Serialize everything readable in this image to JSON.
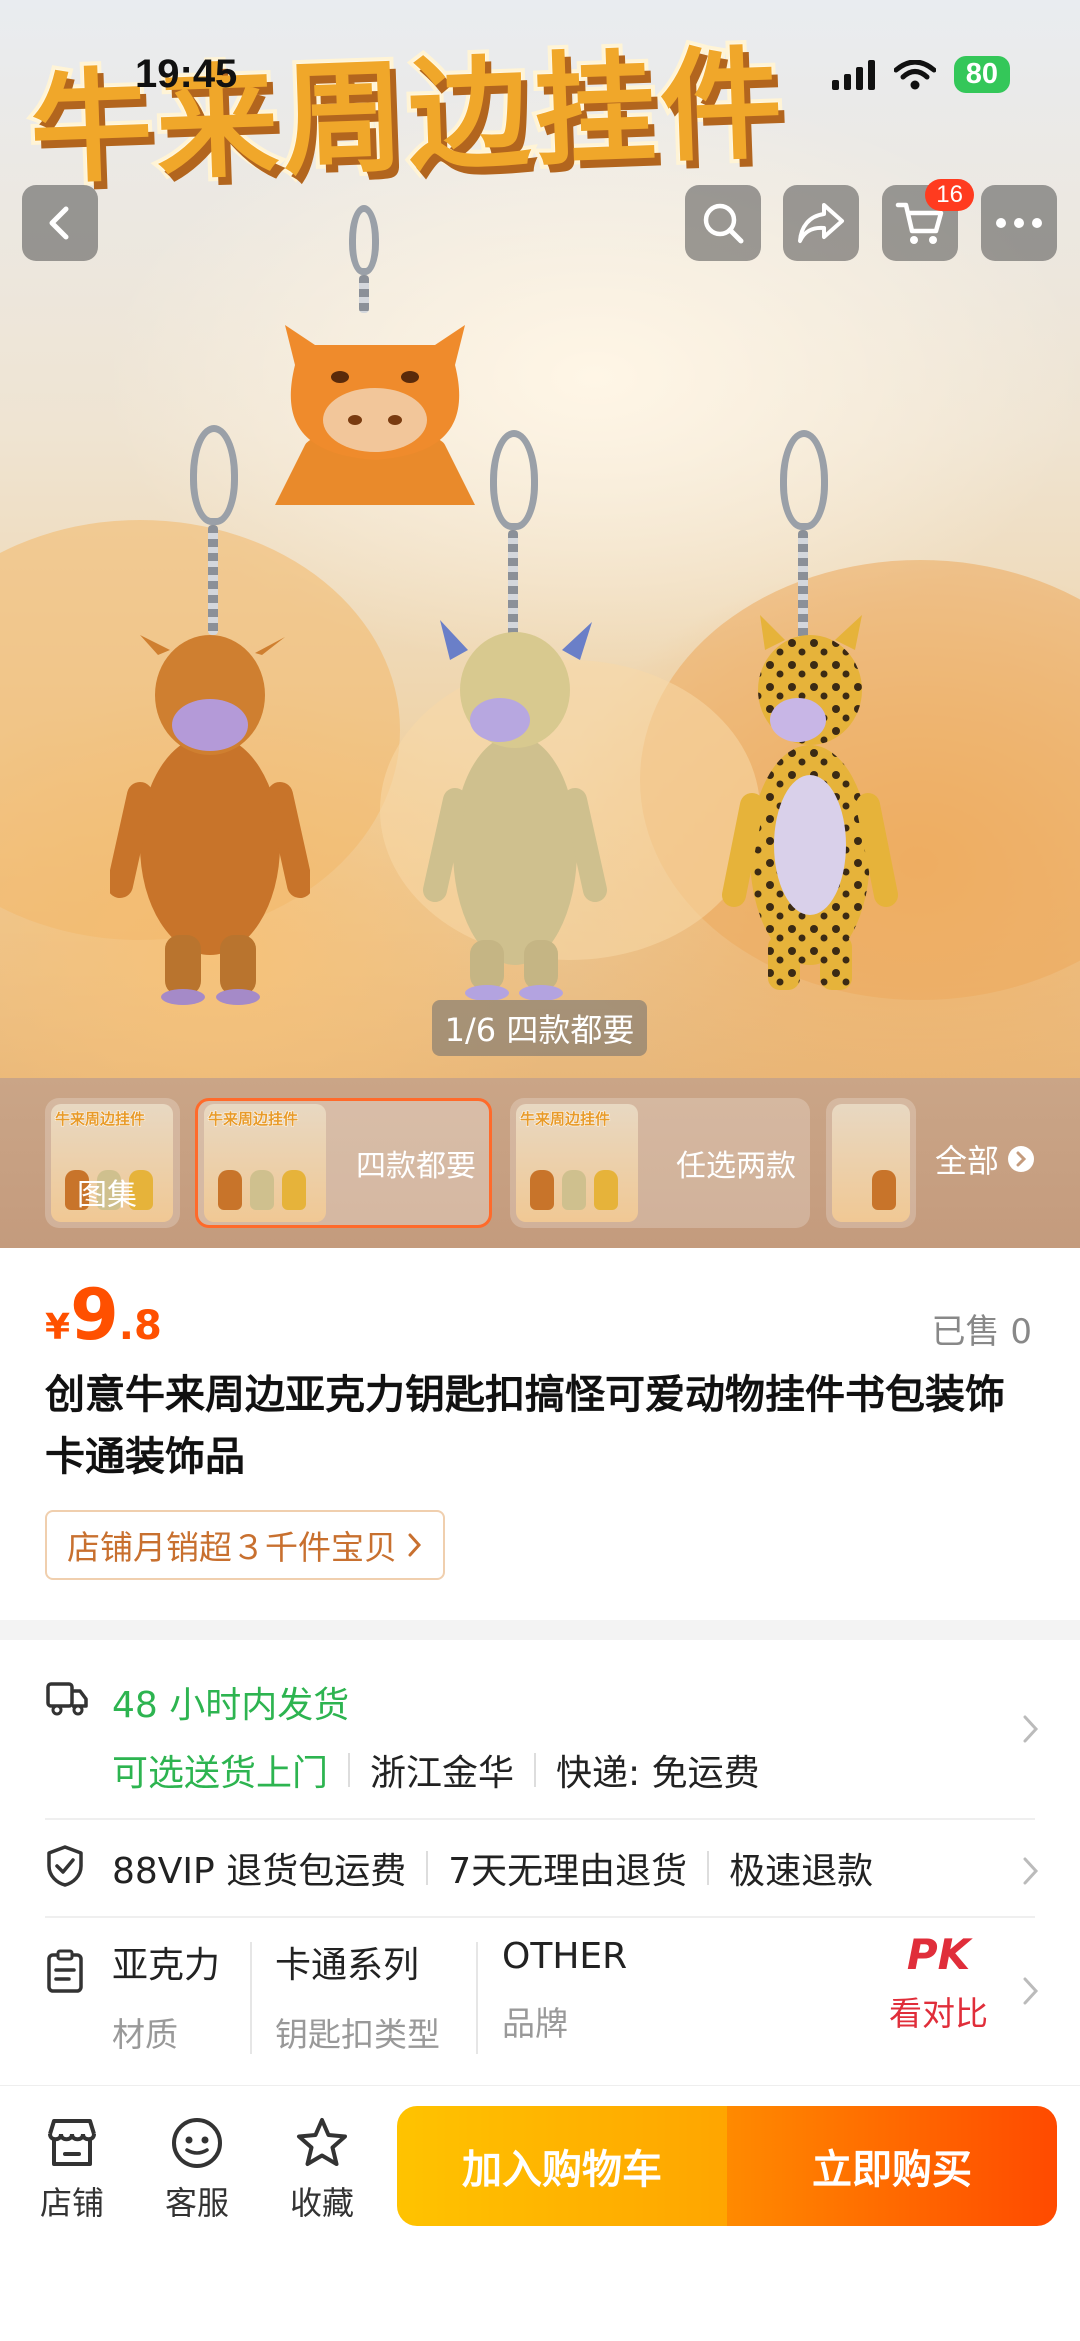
{
  "status_bar": {
    "time": "19:45",
    "battery": "80"
  },
  "banner": {
    "title": "牛来周边挂件"
  },
  "header": {
    "cart_count": "16"
  },
  "gallery": {
    "indicator": "1/6 四款都要",
    "thumbnails": [
      {
        "label": "图集",
        "img_text": "牛来周边挂件"
      },
      {
        "label": "四款都要",
        "img_text": "牛来周边挂件"
      },
      {
        "label": "任选两款",
        "img_text": "牛来周边挂件"
      },
      {
        "label": "全部",
        "img_text": ""
      }
    ]
  },
  "product": {
    "currency": "¥",
    "price_int": "9",
    "price_dec": ".8",
    "sold": "已售 0",
    "title": "创意牛来周边亚克力钥匙扣搞怪可爱动物挂件书包装饰卡通装饰品",
    "shop_tag": "店铺月销超３千件宝贝"
  },
  "shipping": {
    "line1": "48 小时内发货",
    "delivery": "可选送货上门",
    "origin": "浙江金华",
    "fee": "快递: 免运费"
  },
  "service": {
    "items": [
      "88VIP 退货包运费",
      "7天无理由退货",
      "极速退款"
    ]
  },
  "attributes": [
    {
      "value": "亚克力",
      "key": "材质"
    },
    {
      "value": "卡通系列",
      "key": "钥匙扣类型"
    },
    {
      "value": "OTHER",
      "key": "品牌"
    }
  ],
  "compare": {
    "badge": "PK",
    "label": "看对比"
  },
  "bottom_bar": {
    "shop": "店铺",
    "service": "客服",
    "favorite": "收藏",
    "add_to_cart": "加入购物车",
    "buy_now": "立即购买"
  },
  "colors": {
    "accent": "#ff5000",
    "green": "#2db450",
    "pk_red": "#e02e3a"
  }
}
